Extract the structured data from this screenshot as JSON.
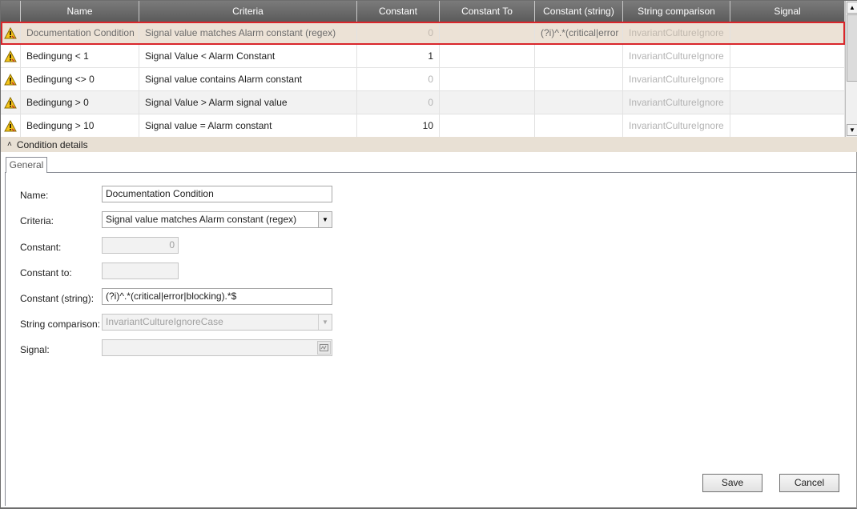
{
  "grid": {
    "columns": [
      "",
      "Name",
      "Criteria",
      "Constant",
      "Constant To",
      "Constant (string)",
      "String comparison",
      "Signal"
    ],
    "rows": [
      {
        "icon": "warning-icon",
        "name": "Documentation Condition",
        "criteria": "Signal value matches Alarm constant (regex)",
        "constant": "0",
        "constant_to": "",
        "constant_string": "(?i)^.*(critical|error",
        "string_comparison": "InvariantCultureIgnore",
        "signal": ""
      },
      {
        "icon": "warning-icon",
        "name": "Bedingung < 1",
        "criteria": "Signal Value < Alarm Constant",
        "constant": "1",
        "constant_to": "",
        "constant_string": "",
        "string_comparison": "InvariantCultureIgnore",
        "signal": ""
      },
      {
        "icon": "warning-icon",
        "name": "Bedingung <> 0",
        "criteria": "Signal value contains Alarm constant",
        "constant": "0",
        "constant_to": "",
        "constant_string": "",
        "string_comparison": "InvariantCultureIgnore",
        "signal": ""
      },
      {
        "icon": "warning-icon",
        "name": "Bedingung > 0",
        "criteria": "Signal Value > Alarm signal value",
        "constant": "0",
        "constant_to": "",
        "constant_string": "",
        "string_comparison": "InvariantCultureIgnore",
        "signal": ""
      },
      {
        "icon": "warning-icon",
        "name": "Bedingung > 10",
        "criteria": "Signal value = Alarm constant",
        "constant": "10",
        "constant_to": "",
        "constant_string": "",
        "string_comparison": "InvariantCultureIgnore",
        "signal": ""
      }
    ]
  },
  "details": {
    "section_label": "Condition details",
    "tab_label": "General",
    "name_label": "Name:",
    "name_value": "Documentation Condition",
    "criteria_label": "Criteria:",
    "criteria_value": "Signal value matches Alarm constant (regex)",
    "constant_label": "Constant:",
    "constant_value": "0",
    "constant_to_label": "Constant to:",
    "constant_to_value": "",
    "constant_string_label": "Constant (string):",
    "constant_string_value": "(?i)^.*(critical|error|blocking).*$",
    "string_comparison_label": "String comparison:",
    "string_comparison_value": "InvariantCultureIgnoreCase",
    "signal_label": "Signal:",
    "signal_value": ""
  },
  "buttons": {
    "save": "Save",
    "cancel": "Cancel"
  },
  "colors": {
    "selection_outline": "#d9262b",
    "selected_row": "#ece2d6",
    "header": "#6b6b6b"
  }
}
